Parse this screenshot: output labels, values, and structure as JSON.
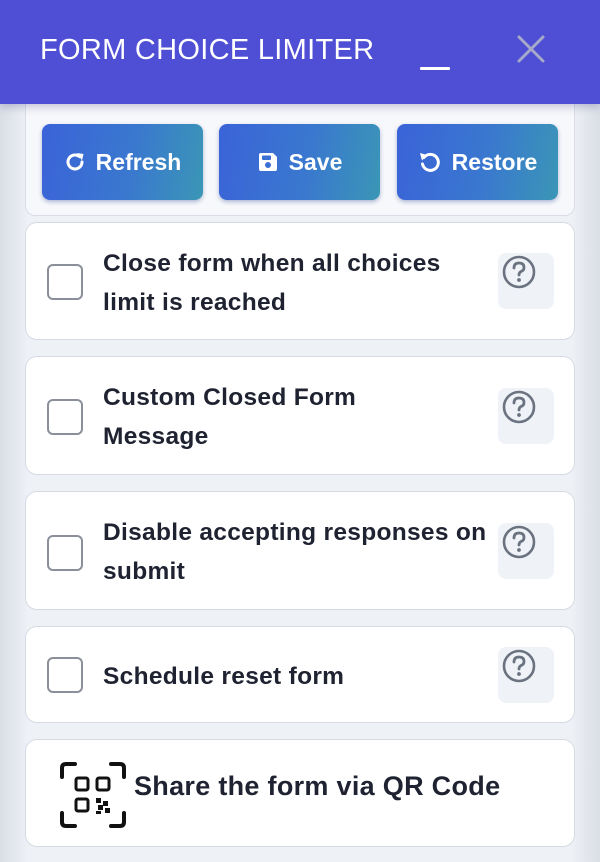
{
  "window": {
    "title": "FORM CHOICE LIMITER",
    "minimize_icon": "minimize-icon",
    "close_icon": "close-icon",
    "accent_color": "#4f4fd6"
  },
  "toolbar": {
    "refresh_label": "Refresh",
    "refresh_icon": "refresh-icon",
    "save_label": "Save",
    "save_icon": "save-disk-icon",
    "restore_label": "Restore",
    "restore_icon": "restore-icon"
  },
  "options": [
    {
      "label": "Close form when all choices limit is reached",
      "checked": false,
      "help_icon": "help-icon"
    },
    {
      "label": "Custom Closed Form Message",
      "checked": false,
      "help_icon": "help-icon"
    },
    {
      "label": "Disable accepting responses on submit",
      "checked": false,
      "help_icon": "help-icon"
    },
    {
      "label": "Schedule reset form",
      "checked": false,
      "help_icon": "help-icon"
    }
  ],
  "qr": {
    "label": "Share the form via QR Code",
    "icon": "qr-code-icon"
  }
}
